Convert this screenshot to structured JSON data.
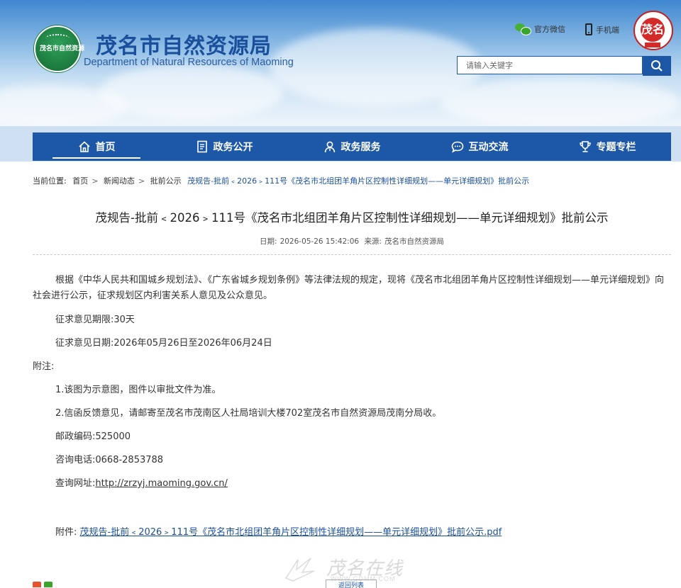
{
  "header": {
    "logo_badge_text": "茂名市自然资源",
    "title": "茂名市自然资源局",
    "subtitle": "Department of Natural Resources of Maoming",
    "links": [
      {
        "label": "官方微信",
        "icon": "wechat-icon"
      },
      {
        "label": "手机端",
        "icon": "mobile-phone-icon"
      }
    ],
    "emblem_text": "茂名",
    "search_placeholder": "请输入关键字"
  },
  "nav": {
    "items": [
      {
        "label": "首页",
        "icon": "home-icon",
        "active": true
      },
      {
        "label": "政务公开",
        "icon": "document-icon",
        "active": false
      },
      {
        "label": "政务服务",
        "icon": "service-person-icon",
        "active": false
      },
      {
        "label": "互动交流",
        "icon": "chat-bubble-icon",
        "active": false
      },
      {
        "label": "专题专栏",
        "icon": "trophy-icon",
        "active": false
      }
    ],
    "color": "#1d58a8"
  },
  "breadcrumb": {
    "prefix": "当前位置:",
    "items": [
      "首页",
      "新闻动态",
      "批前公示"
    ],
    "current": "茂规告-批前﹤2026﹥111号《茂名市北组团羊角片区控制性详细规划——单元详细规划》批前公示"
  },
  "article": {
    "title": "茂规告-批前﹤2026﹥111号《茂名市北组团羊角片区控制性详细规划——单元详细规划》批前公示",
    "date_label": "日期:",
    "date": "2026-05-26 15:42:06",
    "source_label": "来源:",
    "source": "茂名市自然资源局",
    "intro": "根据《中华人民共和国城乡规划法》、《广东省城乡规划条例》等法律法规的规定，现将《茂名市北组团羊角片区控制性详细规划——单元详细规划》向社会进行公示，征求规划区内利害关系人意见及公众意见。",
    "period": "征求意见期限:30天",
    "dates": "征求意见日期:2026年05月26日至2026年06月24日",
    "notes_label": "附注:",
    "note1": "1.该图为示意图，图件以审批文件为准。",
    "note2": "2.信函反馈意见，请邮寄至茂名市茂南区人社局培训大楼702室茂名市自然资源局茂南分局收。",
    "postal": "邮政编码:525000",
    "phone": "咨询电话:0668-2853788",
    "web_label": "查询网址:",
    "web_url": "http://zrzyj.maoming.gov.cn/",
    "attachment_label": "附件:",
    "attachment_name": "茂规告-批前﹤2026﹥111号《茂名市北组团羊角片区控制性详细规划——单元详细规划》批前公示.pdf"
  },
  "watermark": {
    "main": "茂名在线",
    "sub": "WWW.GDMM.COM"
  },
  "footer": {
    "back_label": "返回列表"
  }
}
